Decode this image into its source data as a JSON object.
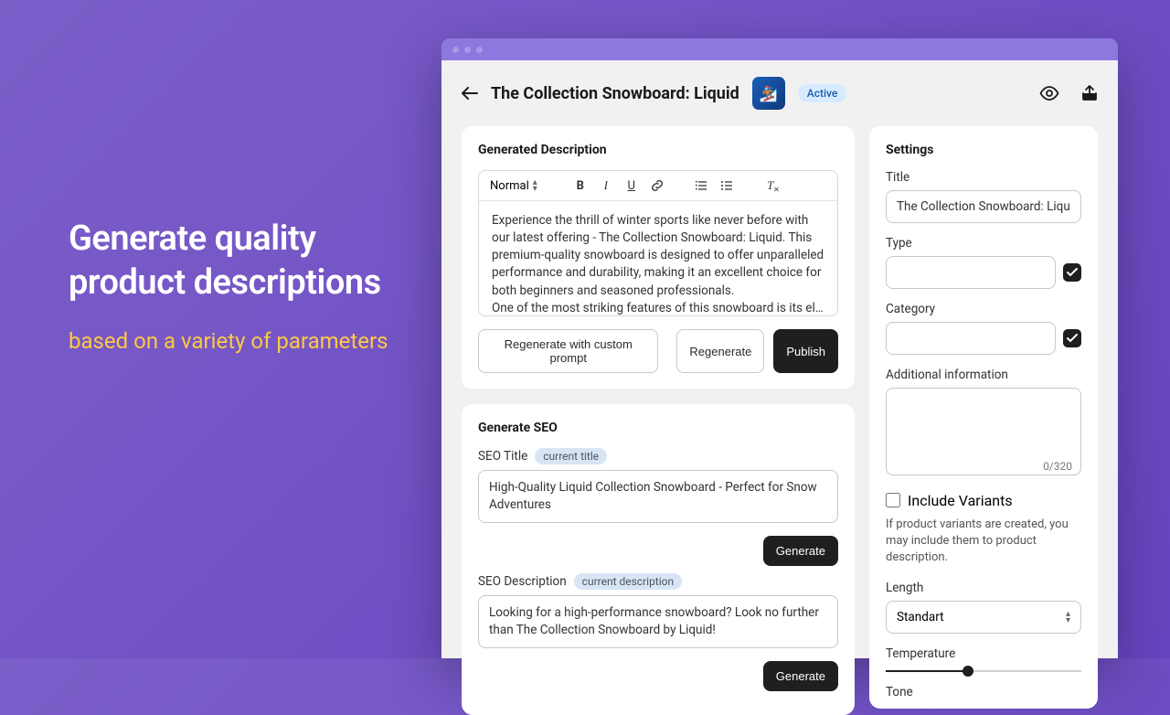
{
  "promo": {
    "headline": "Generate quality product descriptions",
    "subline": "based on a variety of parameters"
  },
  "header": {
    "page_title": "The Collection Snowboard: Liquid",
    "status_badge": "Active"
  },
  "generated": {
    "card_title": "Generated Description",
    "format_selector": "Normal",
    "body_p1": "Experience the thrill of winter sports like never before with our latest offering - The Collection Snowboard: Liquid. This premium-quality snowboard is designed to offer unparalleled performance and durability, making it an excellent choice for both beginners and seasoned professionals.",
    "body_p2": "One of the most striking features of this snowboard is its elegan…",
    "btn_regen_custom": "Regenerate with custom prompt",
    "btn_regen": "Regenerate",
    "btn_publish": "Publish"
  },
  "seo": {
    "card_title": "Generate SEO",
    "title_label": "SEO Title",
    "title_pill": "current title",
    "title_value": "High-Quality Liquid Collection Snowboard - Perfect for Snow Adventures",
    "desc_label": "SEO Description",
    "desc_pill": "current description",
    "desc_value": "Looking for a high-performance snowboard? Look no further than The Collection Snowboard by Liquid!",
    "btn_generate": "Generate"
  },
  "settings": {
    "card_title": "Settings",
    "title_label": "Title",
    "title_value": "The Collection Snowboard: Liquid",
    "type_label": "Type",
    "type_value": "",
    "category_label": "Category",
    "category_value": "",
    "addinfo_label": "Additional information",
    "addinfo_value": "",
    "addinfo_counter": "0/320",
    "include_variants_label": "Include Variants",
    "include_variants_help": "If product variants are created, you may include them to product description.",
    "length_label": "Length",
    "length_value": "Standart",
    "temperature_label": "Temperature",
    "temperature_pct": 42,
    "tone_label": "Tone"
  }
}
